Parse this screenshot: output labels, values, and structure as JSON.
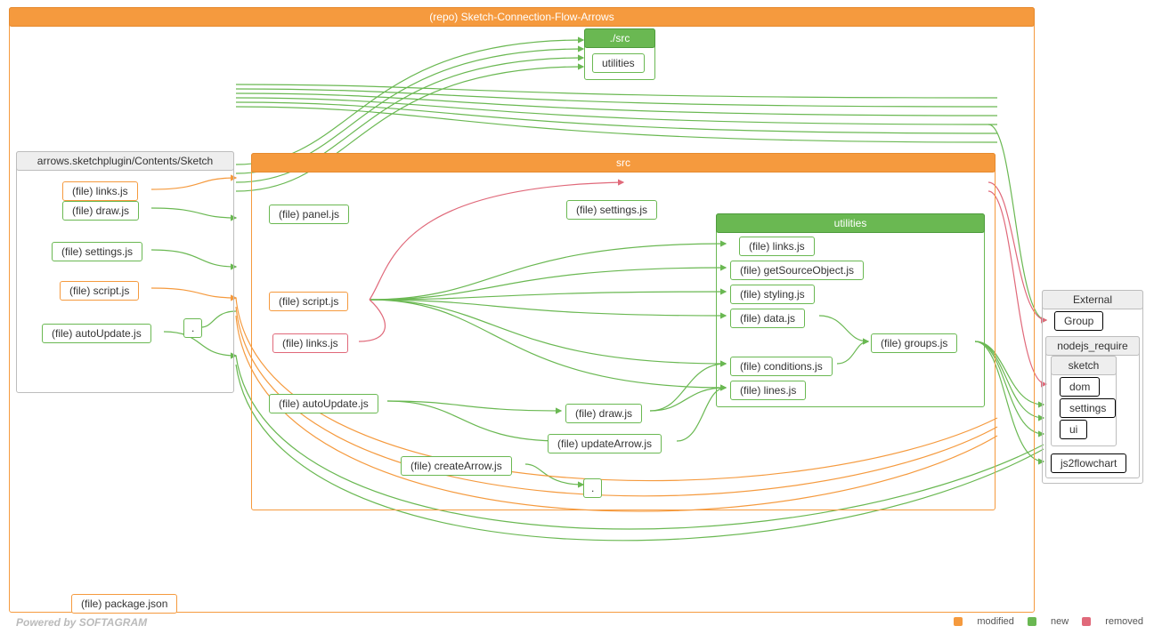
{
  "repo": {
    "title": "(repo) Sketch-Connection-Flow-Arrows"
  },
  "srcRef": {
    "title": "./src",
    "child": "utilities"
  },
  "sketchPlugin": {
    "title": "arrows.sketchplugin/Contents/Sketch",
    "files": {
      "links": "(file) links.js",
      "draw": "(file) draw.js",
      "settings": "(file) settings.js",
      "script": "(file) script.js",
      "autoUpdate": "(file) autoUpdate.js",
      "dot": "."
    }
  },
  "src": {
    "title": "src",
    "files": {
      "panel": "(file) panel.js",
      "settings": "(file) settings.js",
      "script": "(file) script.js",
      "links": "(file) links.js",
      "autoUpdate": "(file) autoUpdate.js",
      "draw": "(file) draw.js",
      "updateArrow": "(file) updateArrow.js",
      "createArrow": "(file) createArrow.js",
      "dot": "."
    },
    "utilities": {
      "title": "utilities",
      "files": {
        "links": "(file) links.js",
        "getSourceObject": "(file) getSourceObject.js",
        "styling": "(file) styling.js",
        "data": "(file) data.js",
        "groups": "(file) groups.js",
        "conditions": "(file) conditions.js",
        "lines": "(file) lines.js"
      }
    }
  },
  "package": "(file) package.json",
  "external": {
    "title": "External",
    "group": "Group",
    "nodejs": {
      "title": "nodejs_require",
      "sketch": {
        "title": "sketch",
        "dom": "dom",
        "settings": "settings",
        "ui": "ui"
      },
      "js2flowchart": "js2flowchart"
    }
  },
  "footer": "Powered by SOFTAGRAM",
  "legend": {
    "modified": "modified",
    "new": "new",
    "removed": "removed"
  }
}
